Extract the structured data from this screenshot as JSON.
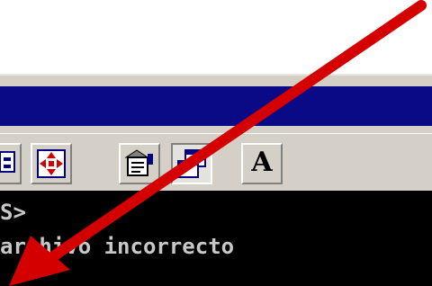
{
  "window": {
    "title": ""
  },
  "toolbar": {
    "buttons": [
      {
        "icon": "properties-icon",
        "state": "normal"
      },
      {
        "icon": "move-icon",
        "state": "normal"
      },
      {
        "icon": "properties-sheet-icon",
        "state": "normal"
      },
      {
        "icon": "restore-window-icon",
        "state": "pressed"
      },
      {
        "icon": "font-icon",
        "label": "A",
        "state": "normal"
      }
    ]
  },
  "console": {
    "lines": [
      "S>",
      "archivo incorrecto"
    ],
    "background": "#000000",
    "text_color": "#c8c8c8"
  },
  "annotation": {
    "arrow_color": "#d40000",
    "arrow_direction": "down-left"
  },
  "colors": {
    "title_bar": "#0a0a86",
    "chrome": "#d4d0c8"
  }
}
